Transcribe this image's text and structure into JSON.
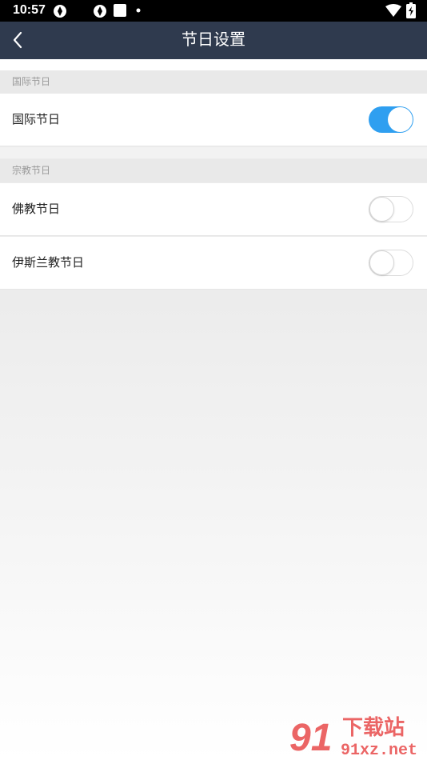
{
  "status_bar": {
    "time": "10:57"
  },
  "nav": {
    "title": "节日设置"
  },
  "sections": [
    {
      "header": "国际节日",
      "rows": [
        {
          "label": "国际节日",
          "enabled": true
        }
      ]
    },
    {
      "header": "宗教节日",
      "rows": [
        {
          "label": "佛教节日",
          "enabled": false
        },
        {
          "label": "伊斯兰教节日",
          "enabled": false
        }
      ]
    }
  ],
  "watermark": {
    "top": "下载站",
    "bottom": "91xz.net"
  },
  "colors": {
    "nav_bg": "#2f3a4e",
    "toggle_on": "#2f9ff0",
    "watermark": "#e84a4a"
  }
}
